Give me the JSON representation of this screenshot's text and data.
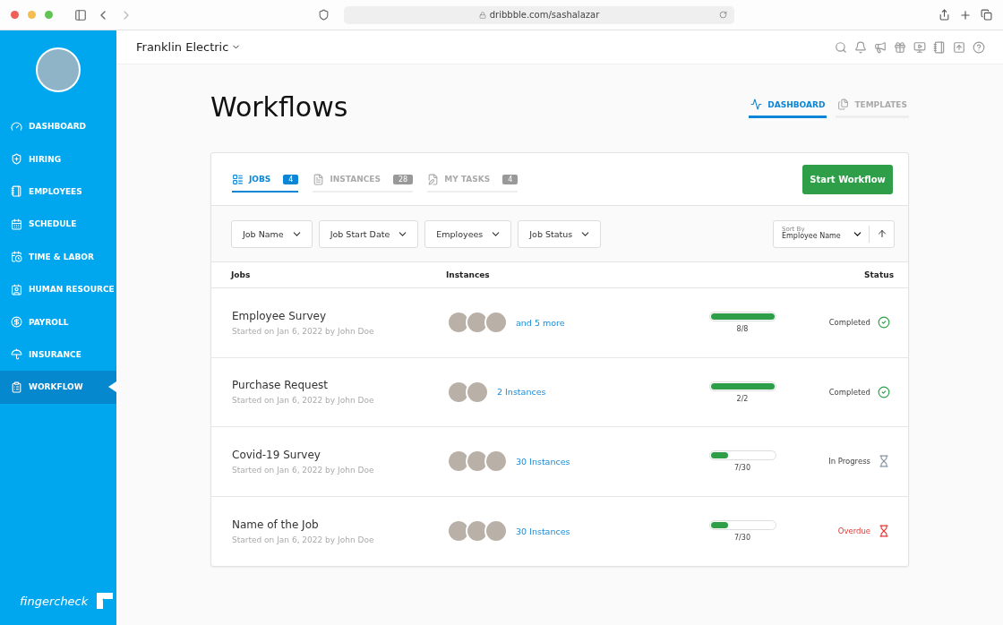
{
  "browser": {
    "url": "dribbble.com/sashalazar"
  },
  "sidebar": {
    "items": [
      {
        "label": "DASHBOARD",
        "selected": false
      },
      {
        "label": "HIRING",
        "selected": false
      },
      {
        "label": "EMPLOYEES",
        "selected": false
      },
      {
        "label": "SCHEDULE",
        "selected": false
      },
      {
        "label": "TIME & LABOR",
        "selected": false
      },
      {
        "label": "HUMAN RESOURCE",
        "selected": false
      },
      {
        "label": "PAYROLL",
        "selected": false
      },
      {
        "label": "INSURANCE",
        "selected": false
      },
      {
        "label": "WORKFLOW",
        "selected": true
      }
    ],
    "brand": "fingercheck"
  },
  "header": {
    "company": "Franklin Electric"
  },
  "page": {
    "title": "Workflows",
    "view_tabs": [
      {
        "label": "DASHBOARD",
        "selected": true
      },
      {
        "label": "TEMPLATES",
        "selected": false
      }
    ]
  },
  "card": {
    "tabs": [
      {
        "label": "JOBS",
        "count": "4",
        "selected": true
      },
      {
        "label": "INSTANCES",
        "count": "28",
        "selected": false
      },
      {
        "label": "MY TASKS",
        "count": "4",
        "selected": false
      }
    ],
    "start_button": "Start Workflow",
    "filters": [
      "Job Name",
      "Job Start Date",
      "Employees",
      "Job Status"
    ],
    "sort": {
      "label": "Sort By",
      "value": "Employee Name"
    },
    "columns": [
      "Jobs",
      "Instances",
      "Status"
    ],
    "rows": [
      {
        "name": "Employee Survey",
        "subtitle": "Started on Jan 6, 2022 by John Doe",
        "avatars": [
          {
            "kind": "photo"
          },
          {
            "kind": "photo"
          },
          {
            "kind": "photo"
          }
        ],
        "instances": "and 5 more",
        "level": 1,
        "progress": "8/8",
        "status": "Completed",
        "kind": "completed"
      },
      {
        "name": "Purchase Request",
        "subtitle": "Started on Jan 6, 2022 by John Doe",
        "avatars": [
          {
            "kind": "photo"
          },
          {
            "kind": "photo"
          }
        ],
        "instances": "2 Instances",
        "level": 1,
        "progress": "2/2",
        "status": "Completed",
        "kind": "completed"
      },
      {
        "name": "Covid-19 Survey",
        "subtitle": "Started on Jan 6, 2022 by John Doe",
        "avatars": [
          {
            "kind": "photo"
          },
          {
            "kind": "photo"
          },
          {
            "kind": "photo"
          }
        ],
        "instances": "30 Instances",
        "level": 0.27,
        "progress": "7/30",
        "status": "In Progress",
        "kind": "in_progress"
      },
      {
        "name": "Name of the Job",
        "subtitle": "Started on Jan 6, 2022 by John Doe",
        "avatars": [
          {
            "kind": "photo"
          },
          {
            "kind": "photo"
          },
          {
            "kind": "photo"
          }
        ],
        "instances": "30 Instances",
        "level": 0.27,
        "progress": "7/30",
        "status": "Overdue",
        "kind": "overdue"
      }
    ]
  }
}
